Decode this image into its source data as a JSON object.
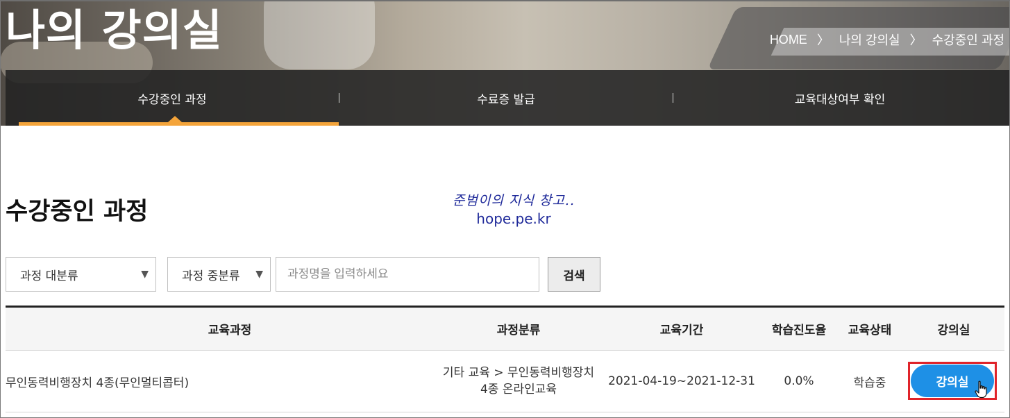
{
  "header": {
    "title": "나의 강의실",
    "breadcrumb": [
      "HOME",
      "나의 강의실",
      "수강중인 과정"
    ]
  },
  "subnav": {
    "tabs": [
      {
        "label": "수강중인 과정",
        "active": true
      },
      {
        "label": "수료증 발급",
        "active": false
      },
      {
        "label": "교육대상여부 확인",
        "active": false
      }
    ],
    "accent_color": "#f4a43a"
  },
  "section": {
    "title": "수강중인 과정"
  },
  "watermark": {
    "line1": "준범이의 지식 창고..",
    "line2": "hope.pe.kr"
  },
  "filters": {
    "category_major": "과정 대분류",
    "category_middle": "과정 중분류",
    "search_placeholder": "과정명을 입력하세요",
    "search_button": "검색"
  },
  "table": {
    "columns": [
      "교육과정",
      "과정분류",
      "교육기간",
      "학습진도율",
      "교육상태",
      "강의실"
    ],
    "rows": [
      {
        "course": "무인동력비행장치 4종(무인멀티콥터)",
        "category_line1": "기타 교육 > 무인동력비행장치",
        "category_line2": "4종 온라인교육",
        "period": "2021-04-19~2021-12-31",
        "progress": "0.0%",
        "status": "학습중",
        "room_button": "강의실"
      }
    ]
  },
  "colors": {
    "room_button": "#1e90e6",
    "highlight_box": "#e0242a"
  }
}
